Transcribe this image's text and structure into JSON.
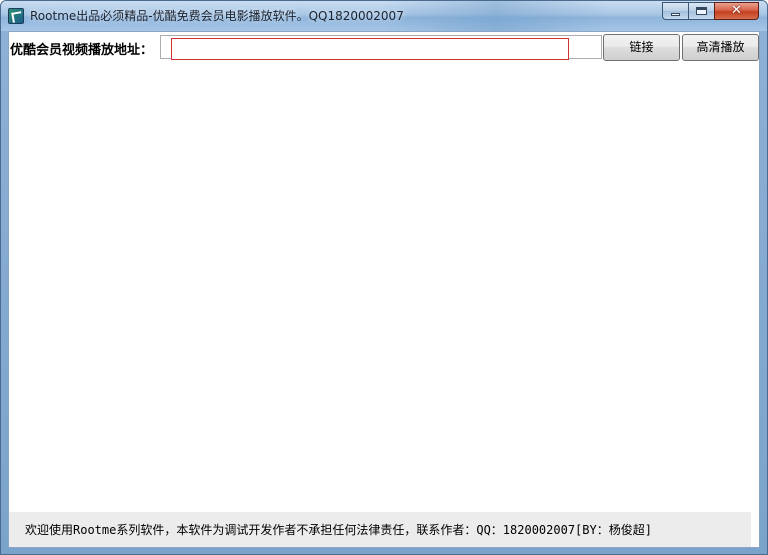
{
  "window": {
    "title": "Rootme出品必须精品-优酷免费会员电影播放软件。QQ1820002007",
    "icon": "app-logo-icon",
    "close_glyph": "✕"
  },
  "toolbar": {
    "url_label": "优酷会员视频播放地址：",
    "url_value": "",
    "url_placeholder": "",
    "link_button_label": "链接",
    "hd_play_button_label": "高清播放"
  },
  "status": {
    "message": "欢迎使用Rootme系列软件，本软件为调试开发作者不承担任何法律责任，联系作者：QQ：1820002007[BY：杨俊超]"
  },
  "colors": {
    "titlebar": "#a8c6e5",
    "close_button": "#c2401f",
    "input_highlight_border": "#cc3333",
    "statusbar_bg": "#ececec"
  }
}
